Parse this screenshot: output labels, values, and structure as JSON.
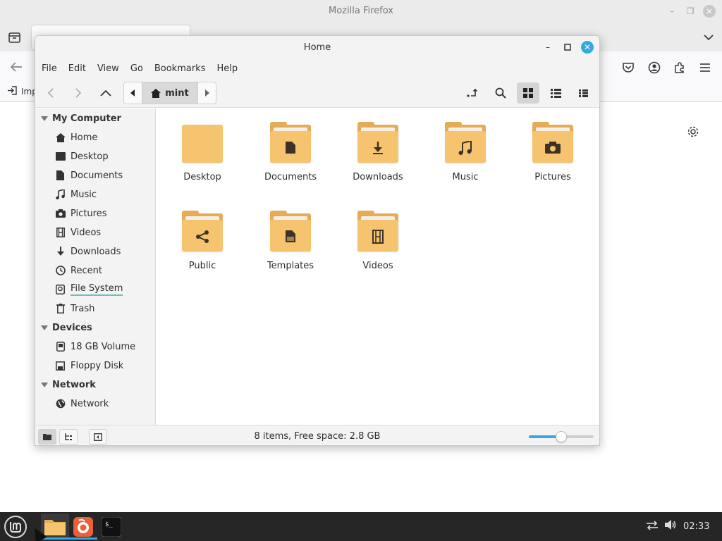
{
  "firefox": {
    "window_title": "Mozilla Firefox",
    "bookmark_toolbar_item": "Imp"
  },
  "nemo": {
    "window_title": "Home",
    "menu": [
      "File",
      "Edit",
      "View",
      "Go",
      "Bookmarks",
      "Help"
    ],
    "breadcrumb": "mint",
    "sidebar": {
      "sections": [
        {
          "title": "My Computer",
          "items": [
            {
              "label": "Home",
              "icon": "home-icon"
            },
            {
              "label": "Desktop",
              "icon": "desktop-icon"
            },
            {
              "label": "Documents",
              "icon": "documents-icon"
            },
            {
              "label": "Music",
              "icon": "music-icon"
            },
            {
              "label": "Pictures",
              "icon": "pictures-icon"
            },
            {
              "label": "Videos",
              "icon": "videos-icon"
            },
            {
              "label": "Downloads",
              "icon": "downloads-icon"
            },
            {
              "label": "Recent",
              "icon": "recent-icon"
            },
            {
              "label": "File System",
              "icon": "drive-icon"
            },
            {
              "label": "Trash",
              "icon": "trash-icon"
            }
          ]
        },
        {
          "title": "Devices",
          "items": [
            {
              "label": "18 GB Volume",
              "icon": "volume-icon"
            },
            {
              "label": "Floppy Disk",
              "icon": "floppy-icon"
            }
          ]
        },
        {
          "title": "Network",
          "items": [
            {
              "label": "Network",
              "icon": "network-icon"
            }
          ]
        }
      ]
    },
    "files": [
      {
        "name": "Desktop",
        "glyph": "none"
      },
      {
        "name": "Documents",
        "glyph": "document"
      },
      {
        "name": "Downloads",
        "glyph": "download"
      },
      {
        "name": "Music",
        "glyph": "music"
      },
      {
        "name": "Pictures",
        "glyph": "camera"
      },
      {
        "name": "Public",
        "glyph": "share"
      },
      {
        "name": "Templates",
        "glyph": "template"
      },
      {
        "name": "Videos",
        "glyph": "film"
      }
    ],
    "status_text": "8 items, Free space: 2.8 GB",
    "zoom_level": 0.5
  },
  "taskbar": {
    "clock": "02:33"
  },
  "colors": {
    "accent": "#35a8e0",
    "folder": "#f6c46e",
    "taskbar": "#262626"
  }
}
